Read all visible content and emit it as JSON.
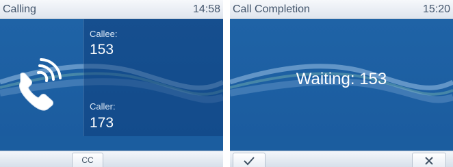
{
  "calling_screen": {
    "title": "Calling",
    "time": "14:58",
    "callee_label": "Callee:",
    "callee_number": "153",
    "caller_label": "Caller:",
    "caller_number": "173",
    "softkey_cc": "CC",
    "icon": "phone-ringing-icon"
  },
  "completion_screen": {
    "title": "Call Completion",
    "time": "15:20",
    "status_text": "Waiting: 153",
    "softkey_ok_icon": "checkmark-icon",
    "softkey_cancel_icon": "close-icon"
  },
  "colors": {
    "screen_blue": "#1f63a6",
    "titlebar": "#e6ebf2",
    "title_text": "#42546b"
  }
}
